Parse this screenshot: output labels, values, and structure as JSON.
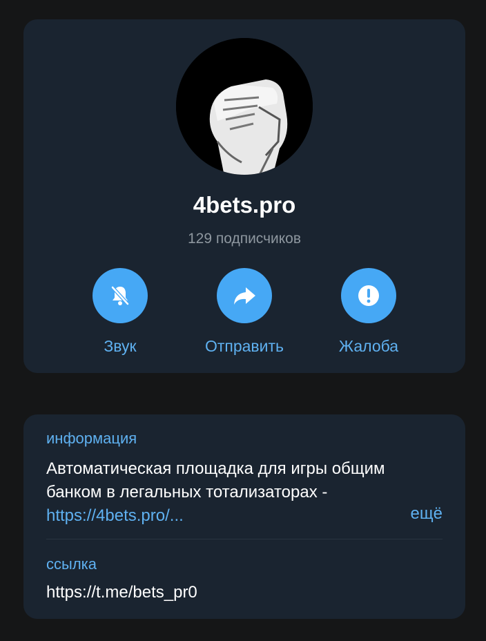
{
  "channel": {
    "name": "4bets.pro",
    "subscribers": "129 подписчиков",
    "avatar_icon": "arm-wrestling-hands-icon"
  },
  "actions": [
    {
      "label": "Звук",
      "icon": "bell-muted-icon"
    },
    {
      "label": "Отправить",
      "icon": "share-arrow-icon"
    },
    {
      "label": "Жалоба",
      "icon": "exclamation-icon"
    }
  ],
  "info": {
    "label": "информация",
    "description_text": "Автоматическая площадка для игры общим банком в легальных тотализаторах - ",
    "description_link": "https://4bets.pro/...",
    "more_label": "ещё"
  },
  "link": {
    "label": "ссылка",
    "value": "https://t.me/bets_pr0"
  },
  "colors": {
    "background": "#151617",
    "card": "#1a2430",
    "accent": "#46a8f5",
    "link": "#5fb1f1",
    "muted": "#8e979f"
  }
}
